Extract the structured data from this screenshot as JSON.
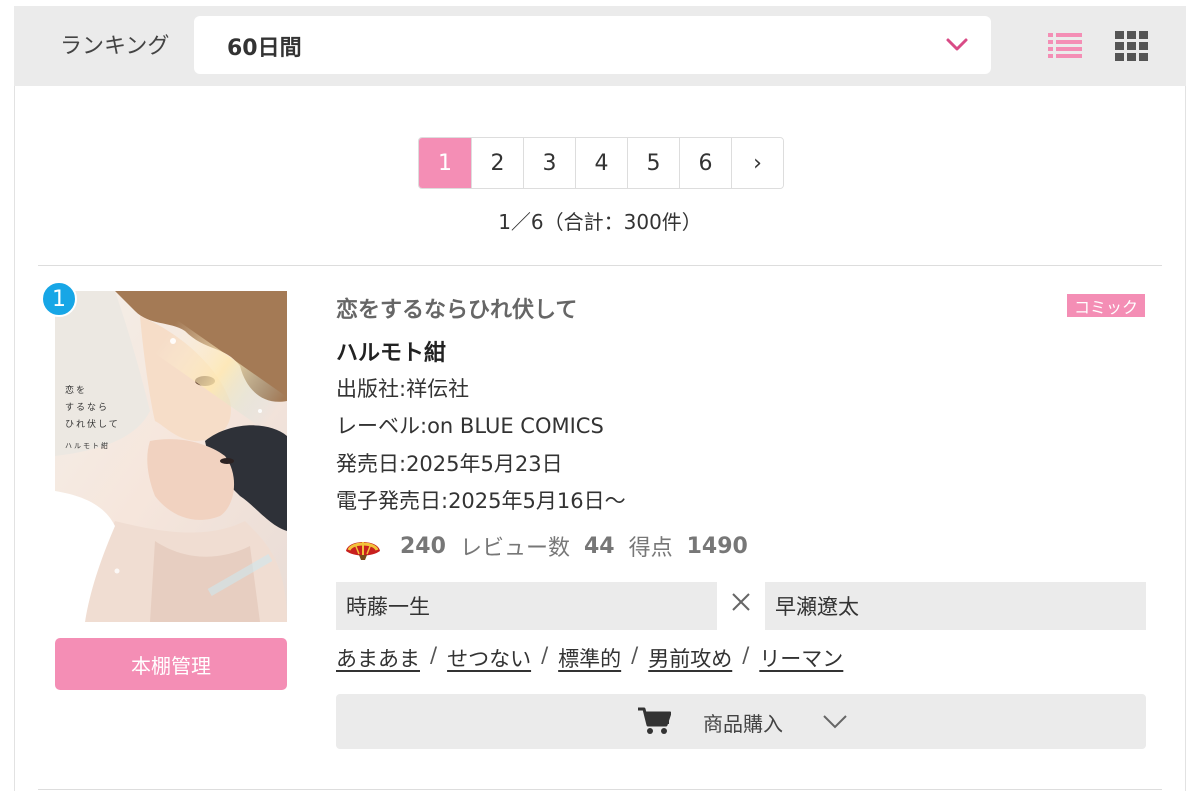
{
  "ranking": {
    "label": "ランキング",
    "period": "60日間"
  },
  "colors": {
    "accent_pink": "#f48eb5",
    "badge_blue": "#17a6e6",
    "bar_gray": "#ebebeb"
  },
  "icons": {
    "period_dropdown": "chevron-down-icon",
    "list_view": "list-view-icon",
    "grid_view": "grid-view-icon",
    "cart": "cart-icon",
    "buy_toggle": "chevron-down-icon",
    "stats": "fan-icon",
    "couple_separator": "cross-icon"
  },
  "pagination": {
    "pages": [
      "1",
      "2",
      "3",
      "4",
      "5",
      "6",
      "›"
    ],
    "active_page": "1",
    "summary": "1／6（合計：300件）"
  },
  "item": {
    "rank": "1",
    "cover_text": {
      "title_lines": [
        "恋を",
        "するなら",
        "ひれ伏して"
      ],
      "author": "ハルモト紺"
    },
    "shelf_button": "本棚管理",
    "title": "恋をするならひれ伏して",
    "genre": "コミック",
    "author": "ハルモト紺",
    "publisher": "出版社:祥伝社",
    "label": "レーベル:on BLUE COMICS",
    "release_date": "発売日:2025年5月23日",
    "ebook_release_date": "電子発売日:2025年5月16日～",
    "stats": {
      "fan_count": "240",
      "review_label": "レビュー数",
      "review_count": "44",
      "score_label": "得点",
      "score": "1490"
    },
    "couple": {
      "left": "時藤一生",
      "right": "早瀬遼太"
    },
    "tags": [
      "あまあま",
      "せつない",
      "標準的",
      "男前攻め",
      "リーマン"
    ],
    "tag_separator": "/",
    "buy_button": "商品購入"
  }
}
